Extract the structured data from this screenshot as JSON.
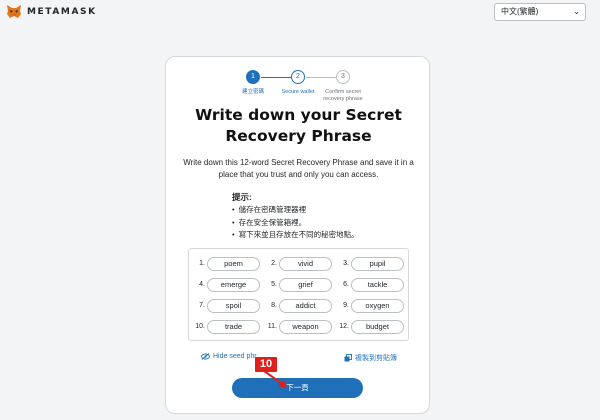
{
  "header": {
    "logo_text": "METAMASK",
    "language_selected": "中文(繁體)"
  },
  "steps": [
    {
      "number": "1",
      "label": "建立密碼"
    },
    {
      "number": "2",
      "label": "Secure wallet"
    },
    {
      "number": "3",
      "label": "Confirm secret recovery phrase"
    }
  ],
  "title_line1": "Write down your Secret",
  "title_line2": "Recovery Phrase",
  "description": "Write down this 12-word Secret Recovery Phrase and save it in a place that you trust and only you can access.",
  "tips_title": "提示:",
  "tips": [
    "儲存在密碼管理器裡",
    "存在安全保管箱裡。",
    "寫下來並且存放在不同的秘密地點。"
  ],
  "phrase": [
    {
      "num": "1.",
      "word": "poem"
    },
    {
      "num": "2.",
      "word": "vivid"
    },
    {
      "num": "3.",
      "word": "pupil"
    },
    {
      "num": "4.",
      "word": "emerge"
    },
    {
      "num": "5.",
      "word": "grief"
    },
    {
      "num": "6.",
      "word": "tackle"
    },
    {
      "num": "7.",
      "word": "spoil"
    },
    {
      "num": "8.",
      "word": "addict"
    },
    {
      "num": "9.",
      "word": "oxygen"
    },
    {
      "num": "10.",
      "word": "trade"
    },
    {
      "num": "11.",
      "word": "weapon"
    },
    {
      "num": "12.",
      "word": "budget"
    }
  ],
  "hide_label": "Hide seed phr",
  "copy_label": "複製到剪貼簿",
  "next_label": "下一頁",
  "annotation": "10",
  "colors": {
    "accent": "#1f6fb9",
    "annotation": "#e0201b"
  }
}
